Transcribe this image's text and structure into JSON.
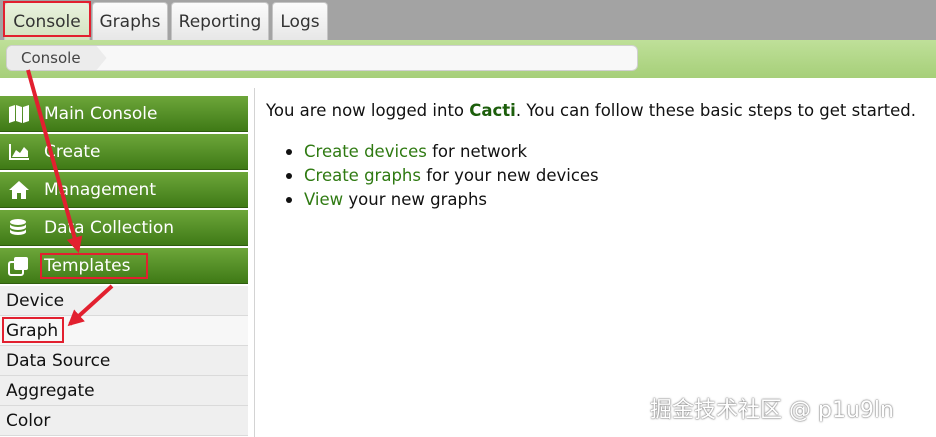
{
  "tabs": [
    {
      "label": "Console",
      "active": true
    },
    {
      "label": "Graphs"
    },
    {
      "label": "Reporting"
    },
    {
      "label": "Logs"
    }
  ],
  "breadcrumb": {
    "items": [
      "Console"
    ]
  },
  "sidebar": {
    "menus": [
      {
        "label": "Main Console",
        "icon": "map-icon"
      },
      {
        "label": "Create",
        "icon": "area-chart-icon"
      },
      {
        "label": "Management",
        "icon": "home-icon"
      },
      {
        "label": "Data Collection",
        "icon": "database-icon"
      },
      {
        "label": "Templates",
        "icon": "clone-icon"
      }
    ],
    "template_items": [
      "Device",
      "Graph",
      "Data Source",
      "Aggregate",
      "Color"
    ]
  },
  "main": {
    "intro_before": "You are now logged into ",
    "intro_app": "Cacti",
    "intro_after": ". You can follow these basic steps to get started.",
    "steps": [
      {
        "link": "Create devices",
        "text": " for network"
      },
      {
        "link": "Create graphs",
        "text": " for your new devices"
      },
      {
        "link": "View",
        "text": " your new graphs"
      }
    ]
  },
  "watermark": "掘金技术社区 @ p1u9ln",
  "colors": {
    "menu_green": "#4f8a24",
    "link_green": "#2f7a12",
    "annotation_red": "#e2202f"
  }
}
